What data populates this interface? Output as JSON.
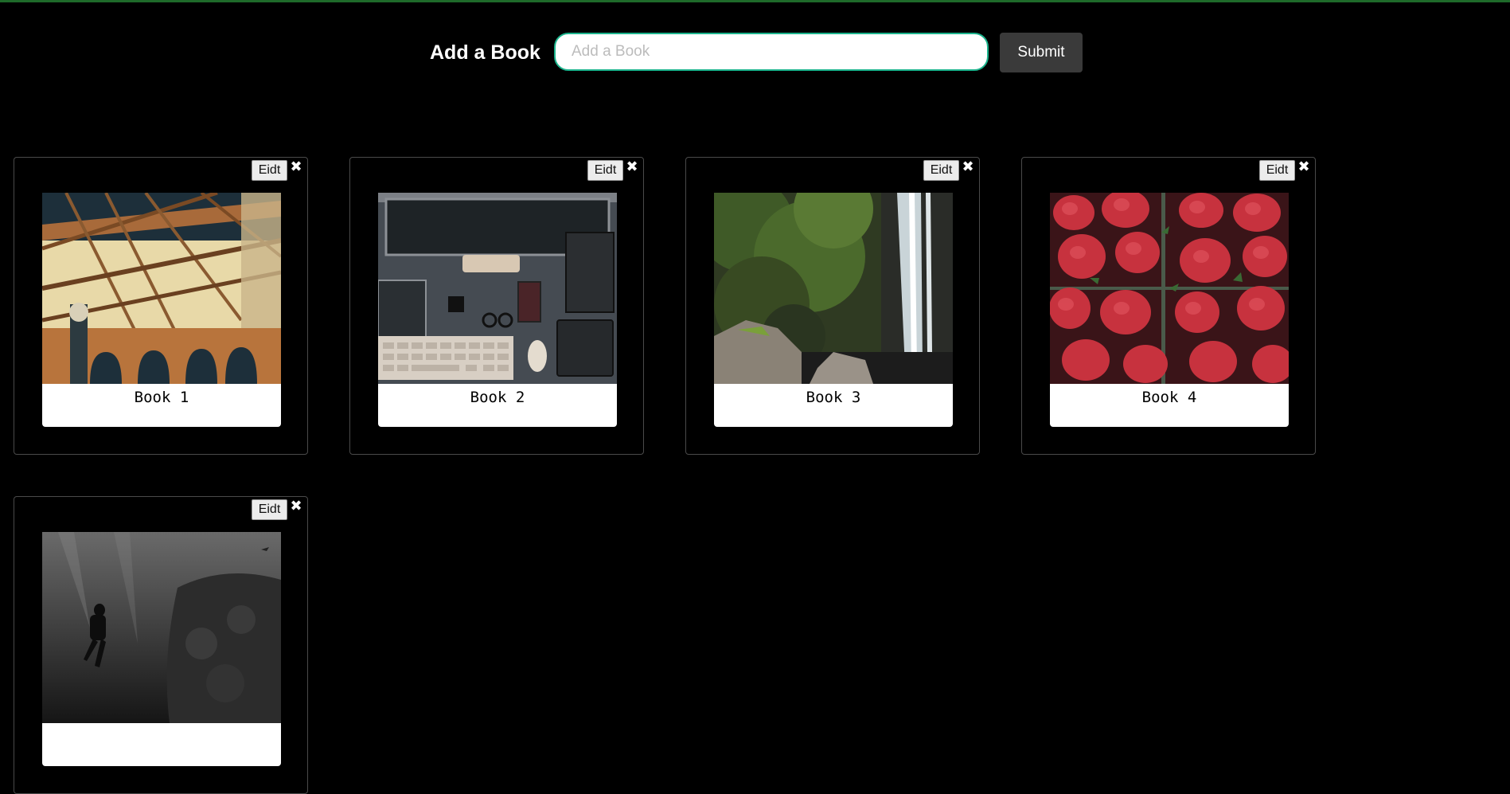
{
  "add": {
    "title": "Add a Book",
    "placeholder": "Add a Book",
    "submit_label": "Submit"
  },
  "books": [
    {
      "label": "Book 1",
      "edit_label": "Eidt",
      "close_glyph": "✖",
      "image": "steel-bridge-arches"
    },
    {
      "label": "Book 2",
      "edit_label": "Eidt",
      "close_glyph": "✖",
      "image": "desk-workspace-flatlay"
    },
    {
      "label": "Book 3",
      "edit_label": "Eidt",
      "close_glyph": "✖",
      "image": "waterfall-mossy-cliff"
    },
    {
      "label": "Book 4",
      "edit_label": "Eidt",
      "close_glyph": "✖",
      "image": "strawberries"
    },
    {
      "label": "",
      "edit_label": "Eidt",
      "close_glyph": "✖",
      "image": "scuba-diver-underwater"
    }
  ],
  "colors": {
    "background": "#000000",
    "input_border": "#1bb38c",
    "submit_bg": "#3a3a3a",
    "top_line": "#1e6a2a"
  }
}
